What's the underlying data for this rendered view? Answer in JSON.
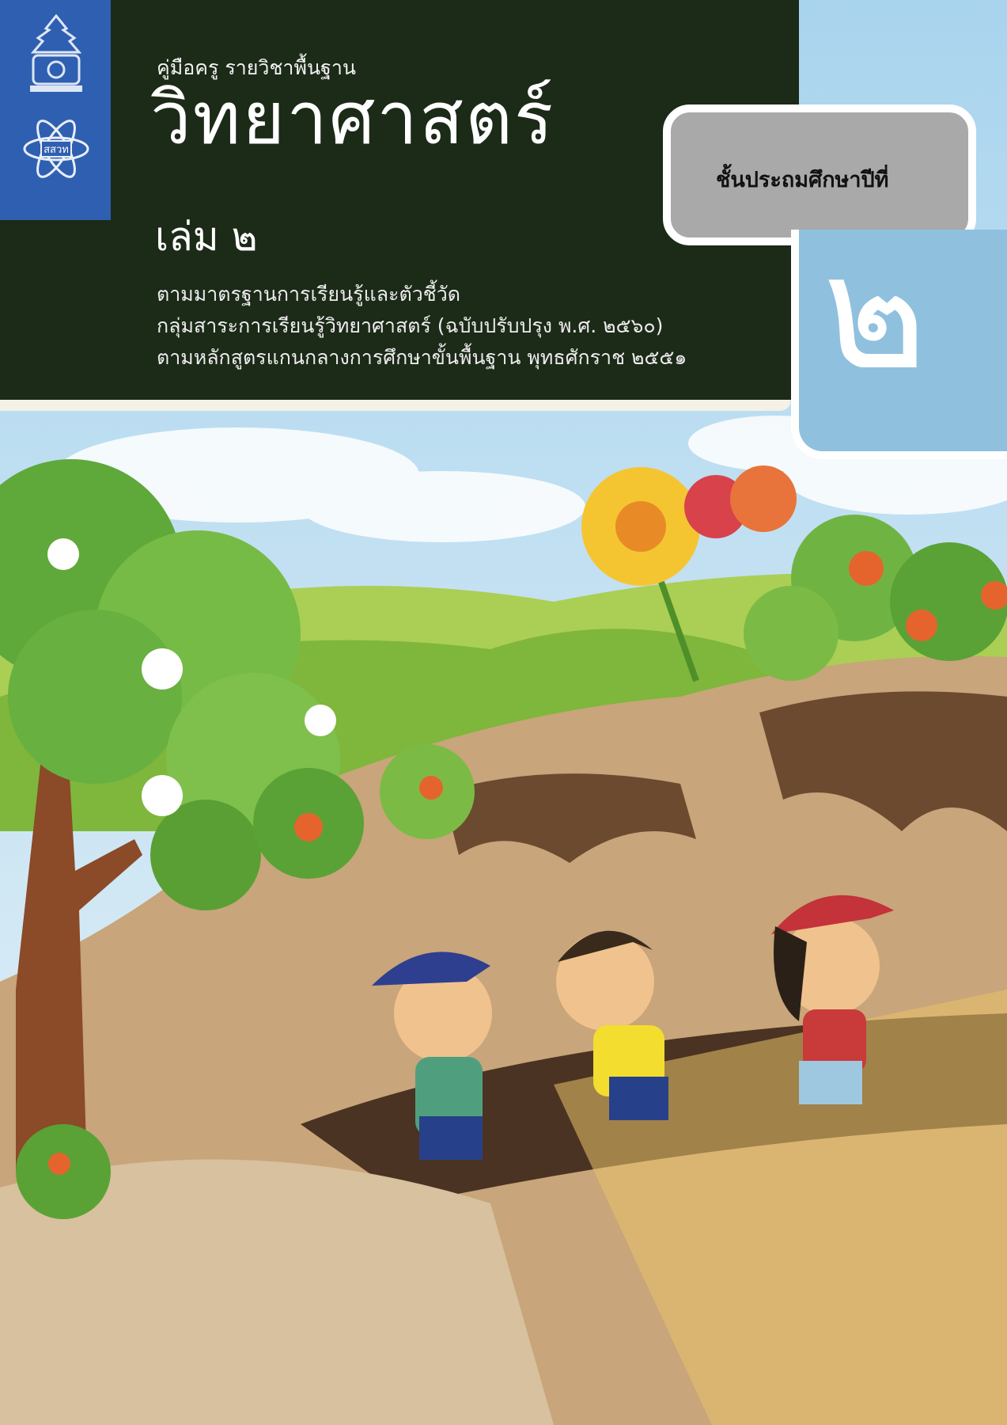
{
  "cover": {
    "subtitle": "คู่มือครู รายวิชาพื้นฐาน",
    "title": "วิทยาศาสตร์",
    "volume": "เล่ม ๒",
    "standards_lines": [
      "ตามมาตรฐานการเรียนรู้และตัวชี้วัด",
      "กลุ่มสาระการเรียนรู้วิทยาศาสตร์ (ฉบับปรับปรุง พ.ศ. ๒๕๖๐)",
      "ตามหลักสูตรแกนกลางการศึกษาขั้นพื้นฐาน พุทธศักราช ๒๕๕๑"
    ],
    "grade_label": "ชั้นประถมศึกษาปีที่",
    "grade_number": "๒",
    "ipst_logo_text": "สสวท"
  },
  "colors": {
    "header_bg": "#1c2a18",
    "logo_strip": "#2f5fb0",
    "grade_box": "#a9a9a9",
    "grade_number_box": "#8fc1df",
    "sky": "#cfe6f2"
  }
}
